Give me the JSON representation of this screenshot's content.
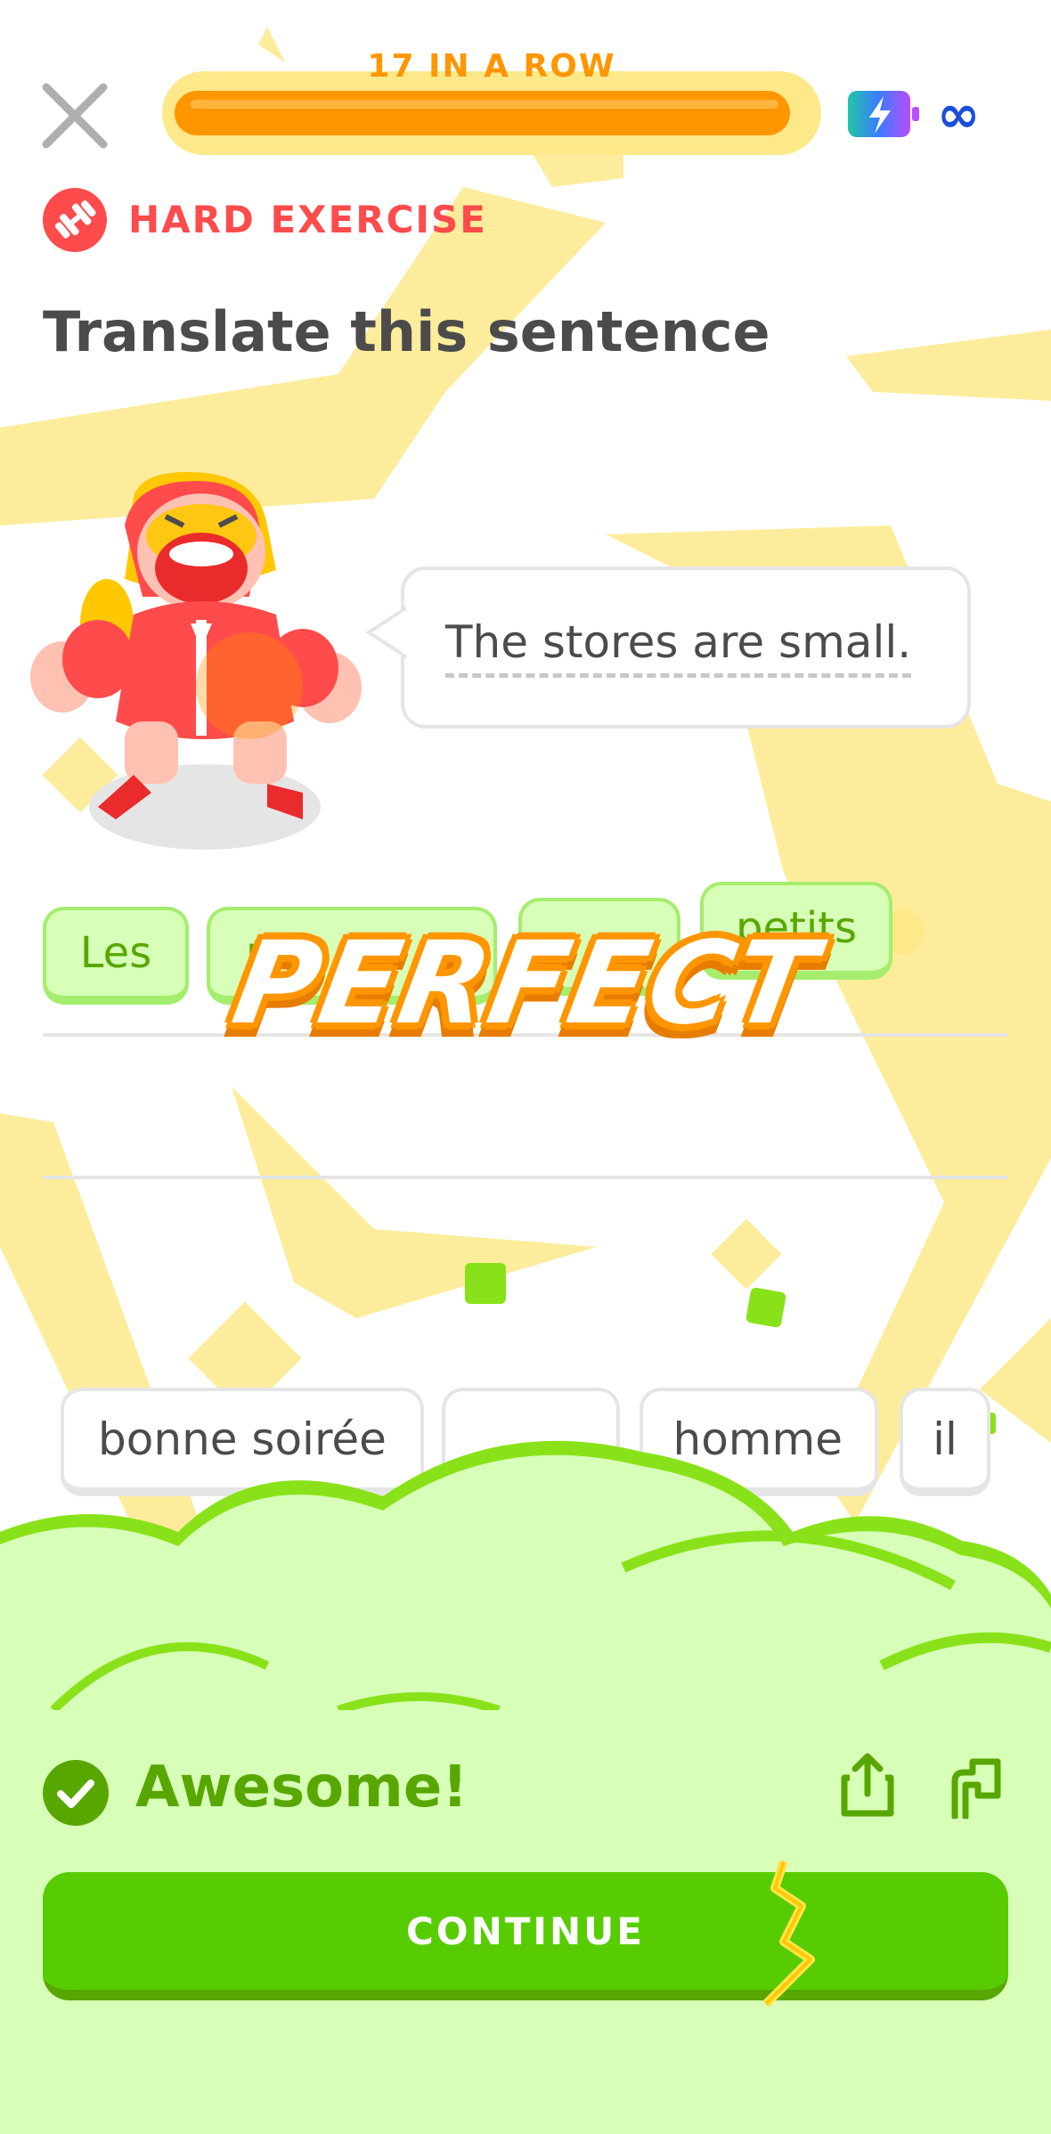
{
  "header": {
    "streak_label": "17 IN A ROW",
    "progress_fraction": 0.97,
    "close_icon": "close-icon",
    "energy_icon": "energy-bolt-icon",
    "energy_value": "∞"
  },
  "exercise": {
    "difficulty_label": "HARD EXERCISE",
    "title": "Translate this sentence",
    "prompt_sentence": "The stores are small."
  },
  "answer": {
    "chips": [
      "Les",
      "m",
      "",
      "petits"
    ]
  },
  "celebration": {
    "text": "PERFECT"
  },
  "word_bank": {
    "words": [
      "bonne soirée",
      "",
      "homme",
      "il"
    ]
  },
  "feedback": {
    "title": "Awesome!",
    "continue_label": "CONTINUE",
    "share_icon": "share-icon",
    "flag_icon": "flag-icon"
  },
  "colors": {
    "streak_orange": "#ff9600",
    "success_green": "#58cc02",
    "success_dark_green": "#58a700",
    "panel_light_green": "#d7ffb8",
    "hard_red": "#ff4b4b",
    "bolt_yellow": "#fde98a"
  }
}
